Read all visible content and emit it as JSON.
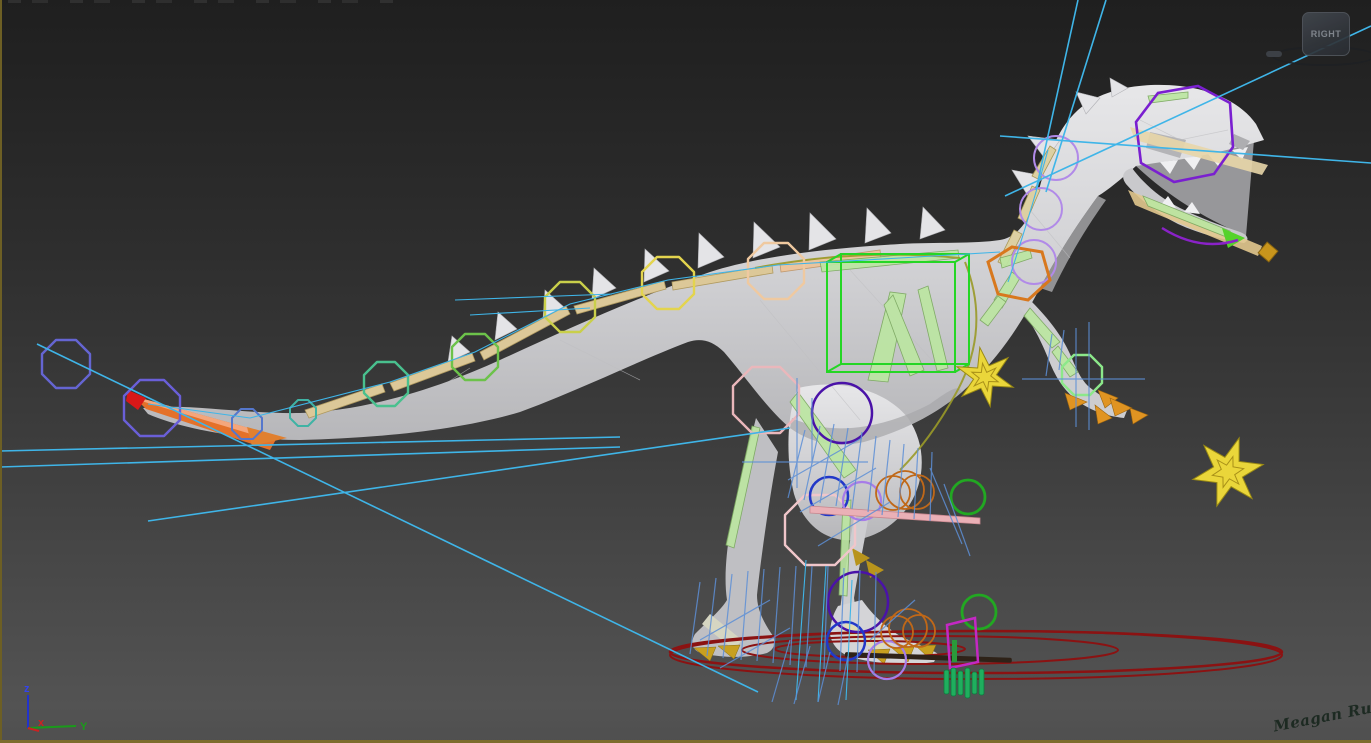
{
  "app": {
    "viewcube_face": "RIGHT",
    "axis": {
      "x": "x",
      "y": "Y",
      "z": "z"
    },
    "signature": "Meagan Ruttan"
  },
  "scene": {
    "subject": "low-poly raptor dinosaur mesh with animation control rig",
    "mesh_color": "#d0d0d3",
    "background_top": "#212121",
    "background_bottom": "#535353",
    "viewport_border_color": "#7c6c2c",
    "rig_controls": {
      "tail_octagon_colors": [
        "#6565d2",
        "#6a5fd8",
        "#5577cc",
        "#3fb3a4",
        "#49c08e",
        "#6cc24a",
        "#c9cf4a",
        "#e3d44e",
        "#efc9a0",
        "#eab7bb",
        "#f0c6ca"
      ],
      "head_octagon_color": "#7a1fd0",
      "neck_circle_color": "#b18ae8",
      "shoulder_octagon_color": "#d8781e",
      "torso_box_color": "#25d625",
      "star_color": "#ead63a",
      "knee_circle_color": "#2238c8",
      "thigh_circle_color": "#4a12a8",
      "toe_circle_color": "#a77ce8",
      "side_circle_color": "#22a822",
      "ankle_coil_color": "#c06818",
      "ground_ring_color": "#8b1212",
      "foot_plate_color": "#c428c4",
      "shin_bar_color": "#eab0b6",
      "spline_color": "#3fb5e8",
      "guide_line_color": "#5d8fd6",
      "bone_colors": [
        "#dcc898",
        "#bce6a2",
        "#e07028",
        "#c8951c",
        "#d81818"
      ]
    }
  }
}
